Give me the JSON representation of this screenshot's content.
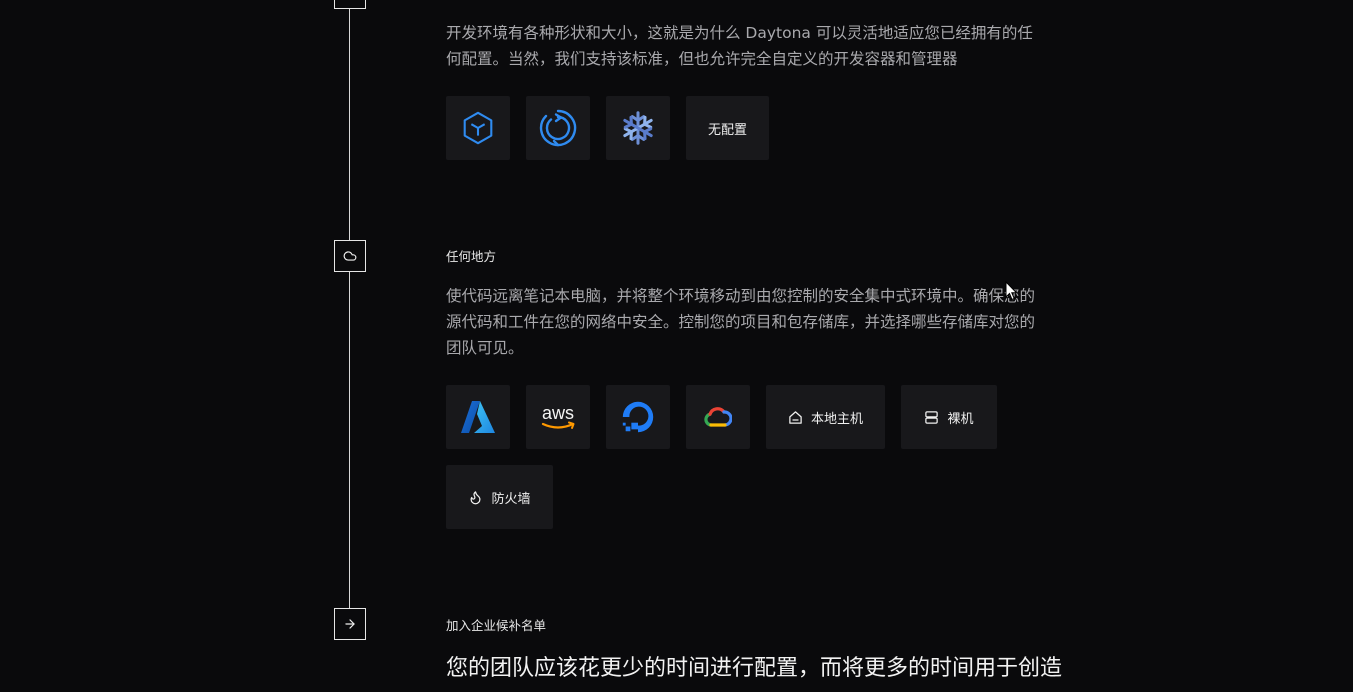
{
  "config_section": {
    "description": "开发环境有各种形状和大小，这就是为什么 Daytona 可以灵活地适应您已经拥有的任何配置。当然，我们支持该标准，但也允许完全自定义的开发容器和管理器",
    "tiles": [
      {
        "icon": "devcontainer-cube-icon"
      },
      {
        "icon": "devfile-refresh-icon"
      },
      {
        "icon": "nix-snowflake-icon"
      },
      {
        "label": "无配置"
      }
    ]
  },
  "anywhere_section": {
    "label": "任何地方",
    "description": "使代码远离笔记本电脑，并将整个环境移动到由您控制的安全集中式环境中。确保您的源代码和工件在您的网络中安全。控制您的项目和包存储库，并选择哪些存储库对您的团队可见。",
    "tiles": [
      {
        "icon": "azure-icon"
      },
      {
        "icon": "aws-icon",
        "text": "aws"
      },
      {
        "icon": "digitalocean-icon"
      },
      {
        "icon": "google-cloud-icon"
      },
      {
        "icon": "home-icon",
        "label": "本地主机"
      },
      {
        "icon": "server-icon",
        "label": "裸机"
      },
      {
        "icon": "flame-icon",
        "label": "防火墙"
      }
    ]
  },
  "waitlist_section": {
    "label": "加入企业候补名单",
    "heading": "您的团队应该花更少的时间进行配置，而将更多的时间用于创造"
  },
  "colors": {
    "background": "#0a0a0c",
    "tile": "#18181b",
    "accent_blue": "#2f8bf0"
  }
}
